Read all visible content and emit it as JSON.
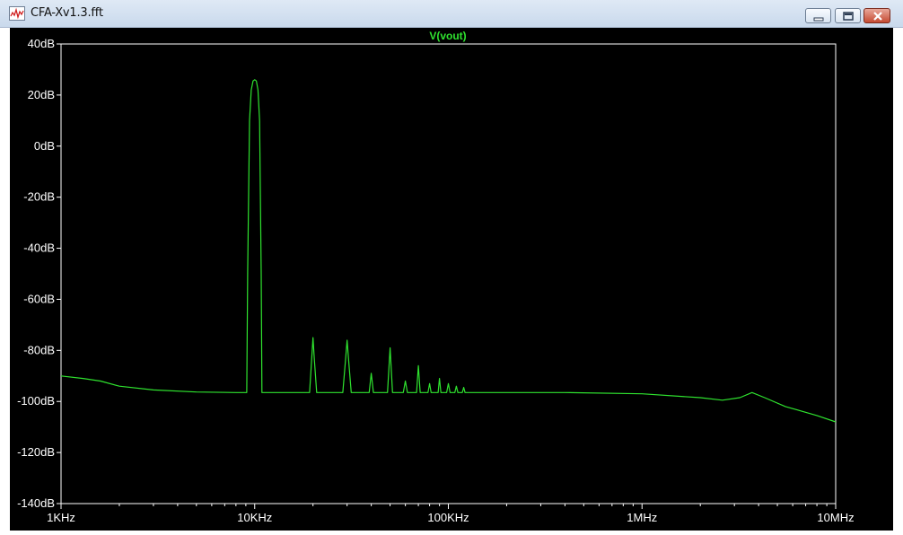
{
  "window": {
    "title": "CFA-Xv1.3.fft",
    "icon": "waveform-icon",
    "controls": {
      "minimize": "minimize-icon",
      "restore": "restore-icon",
      "close": "close-icon"
    }
  },
  "colors": {
    "plot_background": "#000000",
    "axis_and_labels": "#ffffff",
    "trace": "#2fe32f",
    "title_bar": "#d3e1f1"
  },
  "chart_data": {
    "type": "line",
    "title": "V(vout)",
    "xlabel": "",
    "ylabel": "",
    "xscale": "log",
    "xlim": [
      1000,
      10000000
    ],
    "ylim": [
      -140,
      40
    ],
    "x_tick_labels": [
      "1KHz",
      "10KHz",
      "100KHz",
      "1MHz",
      "10MHz"
    ],
    "x_ticks": [
      1000,
      10000,
      100000,
      1000000,
      10000000
    ],
    "y_tick_labels": [
      "40dB",
      "20dB",
      "0dB",
      "-20dB",
      "-40dB",
      "-60dB",
      "-80dB",
      "-100dB",
      "-120dB",
      "-140dB"
    ],
    "y_ticks": [
      40,
      20,
      0,
      -20,
      -40,
      -60,
      -80,
      -100,
      -120,
      -140
    ],
    "grid": false,
    "series": [
      {
        "color": "#2fe32f",
        "x": [
          1000,
          1300,
          1600,
          2000,
          3000,
          5000,
          8000,
          9100,
          9200,
          9400,
          9600,
          9800,
          10000,
          10200,
          10400,
          10600,
          10800,
          10900,
          11000,
          15000,
          19200,
          19700,
          20000,
          20300,
          20900,
          28500,
          29500,
          30000,
          30500,
          31500,
          39000,
          40000,
          41000,
          48500,
          50000,
          51500,
          58500,
          60000,
          61500,
          68500,
          70000,
          71500,
          78500,
          80000,
          81500,
          88500,
          90000,
          91500,
          98000,
          100000,
          102000,
          108000,
          110000,
          112000,
          118000,
          120000,
          122000,
          200000,
          400000,
          1000000,
          2000000,
          2600000,
          3200000,
          3700000,
          4300000,
          5500000,
          8000000,
          10000000
        ],
        "y": [
          -90,
          -91,
          -92,
          -94,
          -95.5,
          -96.3,
          -96.5,
          -96.5,
          -50,
          10,
          22,
          25.5,
          26,
          25.5,
          22,
          10,
          -50,
          -96.5,
          -96.5,
          -96.5,
          -96.5,
          -83,
          -75,
          -83,
          -96.5,
          -96.5,
          -83,
          -76,
          -83,
          -96.5,
          -96.5,
          -89,
          -96.5,
          -96.5,
          -79,
          -96.5,
          -96.5,
          -92,
          -96.5,
          -96.5,
          -86,
          -96.5,
          -96.5,
          -93,
          -96.5,
          -96.5,
          -91,
          -96.5,
          -96.5,
          -93,
          -96.5,
          -96.5,
          -94,
          -96.5,
          -96.5,
          -94.5,
          -96.5,
          -96.5,
          -96.5,
          -97,
          -98.5,
          -99.5,
          -98.5,
          -96.5,
          -98.5,
          -102,
          -105.5,
          -108
        ]
      }
    ]
  }
}
